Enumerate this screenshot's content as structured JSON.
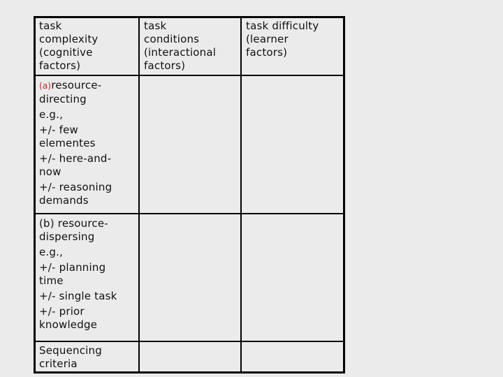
{
  "table": {
    "headers": [
      [
        "task",
        "complexity",
        "(cognitive",
        "factors)"
      ],
      [
        "task",
        "conditions",
        "(interactional",
        "factors)"
      ],
      [
        "task difficulty",
        "(learner",
        "factors)"
      ]
    ],
    "row_a": {
      "label_prefix": "(a)",
      "label_rest": "resource-",
      "label_line2": "directing",
      "eg": "e.g.,",
      "items": [
        [
          "+/- few",
          "elementes"
        ],
        [
          "+/- here-and-",
          "now"
        ],
        [
          "+/- reasoning",
          "demands"
        ]
      ]
    },
    "row_b": {
      "label_line1": "(b) resource-",
      "label_line2": "dispersing",
      "eg": "e.g.,",
      "items": [
        [
          "+/- planning",
          "time"
        ],
        [
          "+/- single task"
        ],
        [
          "+/- prior",
          "knowledge"
        ]
      ]
    },
    "row_c": [
      "Sequencing",
      "criteria"
    ]
  }
}
